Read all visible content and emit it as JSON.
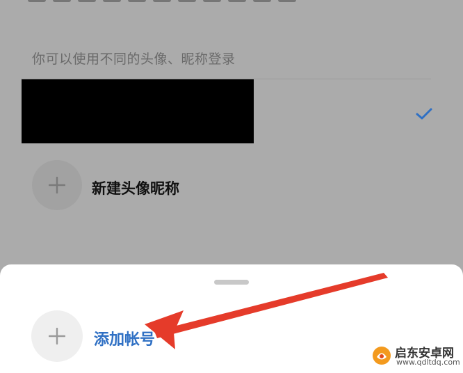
{
  "hint": {
    "text": "你可以使用不同的头像、昵称登录"
  },
  "profile": {
    "selected": true,
    "check_color": "#2f70c4"
  },
  "new_profile": {
    "label": "新建头像昵称"
  },
  "sheet": {
    "add_account_label": "添加帐号",
    "accent_color": "#2f70c4"
  },
  "annotation": {
    "arrow_color": "#e53b2a"
  },
  "watermark": {
    "title": "启东安卓网",
    "url": "www.qdltdq.com"
  },
  "icons": {
    "add": "plus-icon",
    "check": "check-icon",
    "logo": "site-logo-icon"
  }
}
